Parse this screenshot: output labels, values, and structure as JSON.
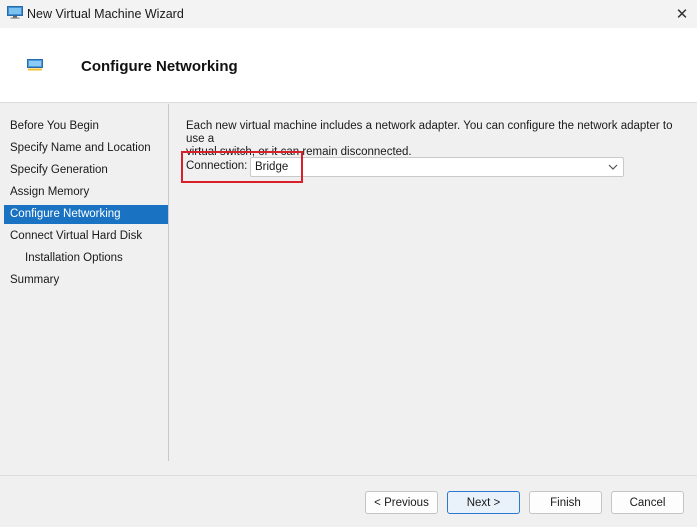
{
  "window": {
    "title": "New Virtual Machine Wizard",
    "close_glyph": "✕"
  },
  "header": {
    "title": "Configure Networking",
    "icon": "network-icon"
  },
  "sidebar": {
    "items": [
      {
        "label": "Before You Begin",
        "active": false
      },
      {
        "label": "Specify Name and Location",
        "active": false
      },
      {
        "label": "Specify Generation",
        "active": false
      },
      {
        "label": "Assign Memory",
        "active": false
      },
      {
        "label": "Configure Networking",
        "active": true
      },
      {
        "label": "Connect Virtual Hard Disk",
        "active": false
      },
      {
        "label": "Installation Options",
        "active": false
      },
      {
        "label": "Summary",
        "active": false
      }
    ]
  },
  "main": {
    "description_line1": "Each new virtual machine includes a network adapter. You can configure the network adapter to use a",
    "description_line2": "virtual switch, or it can remain disconnected.",
    "connection_label": "Connection:",
    "connection_value": "Bridge"
  },
  "buttons": {
    "previous": "< Previous",
    "next": "Next >",
    "finish": "Finish",
    "cancel": "Cancel"
  },
  "colors": {
    "accent": "#1a73c2",
    "highlight": "#d9202a"
  }
}
